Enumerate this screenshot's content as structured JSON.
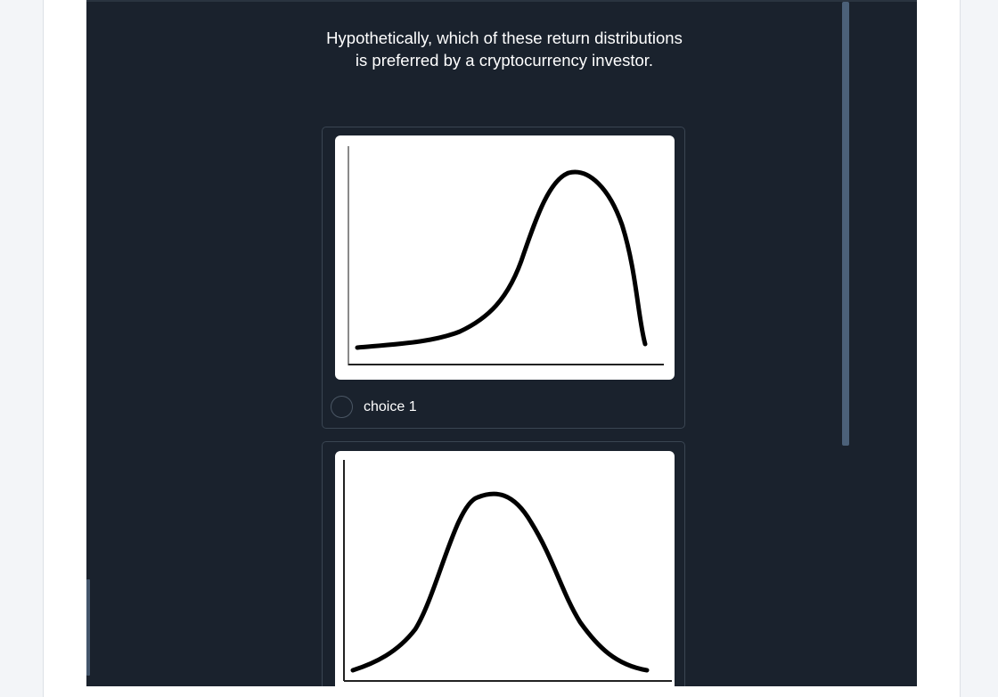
{
  "question": {
    "text": "Hypothetically, which of these return distributions is preferred by a cryptocurrency investor."
  },
  "choices": [
    {
      "label": "choice 1",
      "selected": false,
      "image": "left-skewed-distribution-sketch"
    },
    {
      "label": "",
      "selected": false,
      "image": "symmetric-bell-curve-sketch"
    }
  ],
  "colors": {
    "panel_bg": "#1a222d",
    "page_bg": "#f3f5f8",
    "card_border": "#3a4552",
    "scrollbar": "#4c6179",
    "text": "#ffffff"
  }
}
